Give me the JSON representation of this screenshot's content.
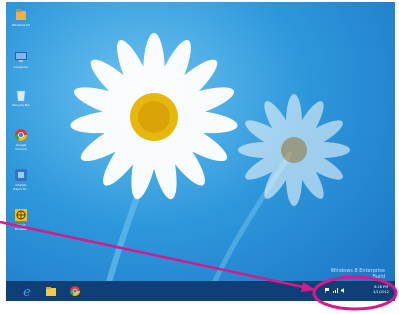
{
  "desktop": {
    "icons": [
      {
        "name": "windows-pc-icon",
        "label": "Windows PC",
        "color": "#e8b24a"
      },
      {
        "name": "computer-icon",
        "label": "Computer",
        "color": "#7ab8ef"
      },
      {
        "name": "recycle-bin-icon",
        "label": "Recycle Bin",
        "color": "#d9ecff"
      },
      {
        "name": "google-chrome-icon",
        "label": "Google\nChrome",
        "color": "#e5382c"
      },
      {
        "name": "intel-app-icon",
        "label": "Intel(R)\nRapid St...",
        "color": "#3b6fc4"
      },
      {
        "name": "globe-app-icon",
        "label": "Smart\nBrowser",
        "color": "#f2c200"
      }
    ],
    "watermark_line1": "Windows 8 Enterprise",
    "watermark_line2": "Build"
  },
  "taskbar": {
    "items": [
      {
        "name": "internet-explorer-icon",
        "color": "#3fa0e8"
      },
      {
        "name": "file-explorer-icon",
        "color": "#f2c94c"
      },
      {
        "name": "chrome-taskbar-icon",
        "color": "#e5382c"
      }
    ],
    "tray_icons": [
      "flag-icon",
      "network-icon",
      "volume-icon"
    ],
    "time": "6:28 PM",
    "date": "4/1/2012"
  },
  "annotation": {
    "color": "#d6198b"
  }
}
